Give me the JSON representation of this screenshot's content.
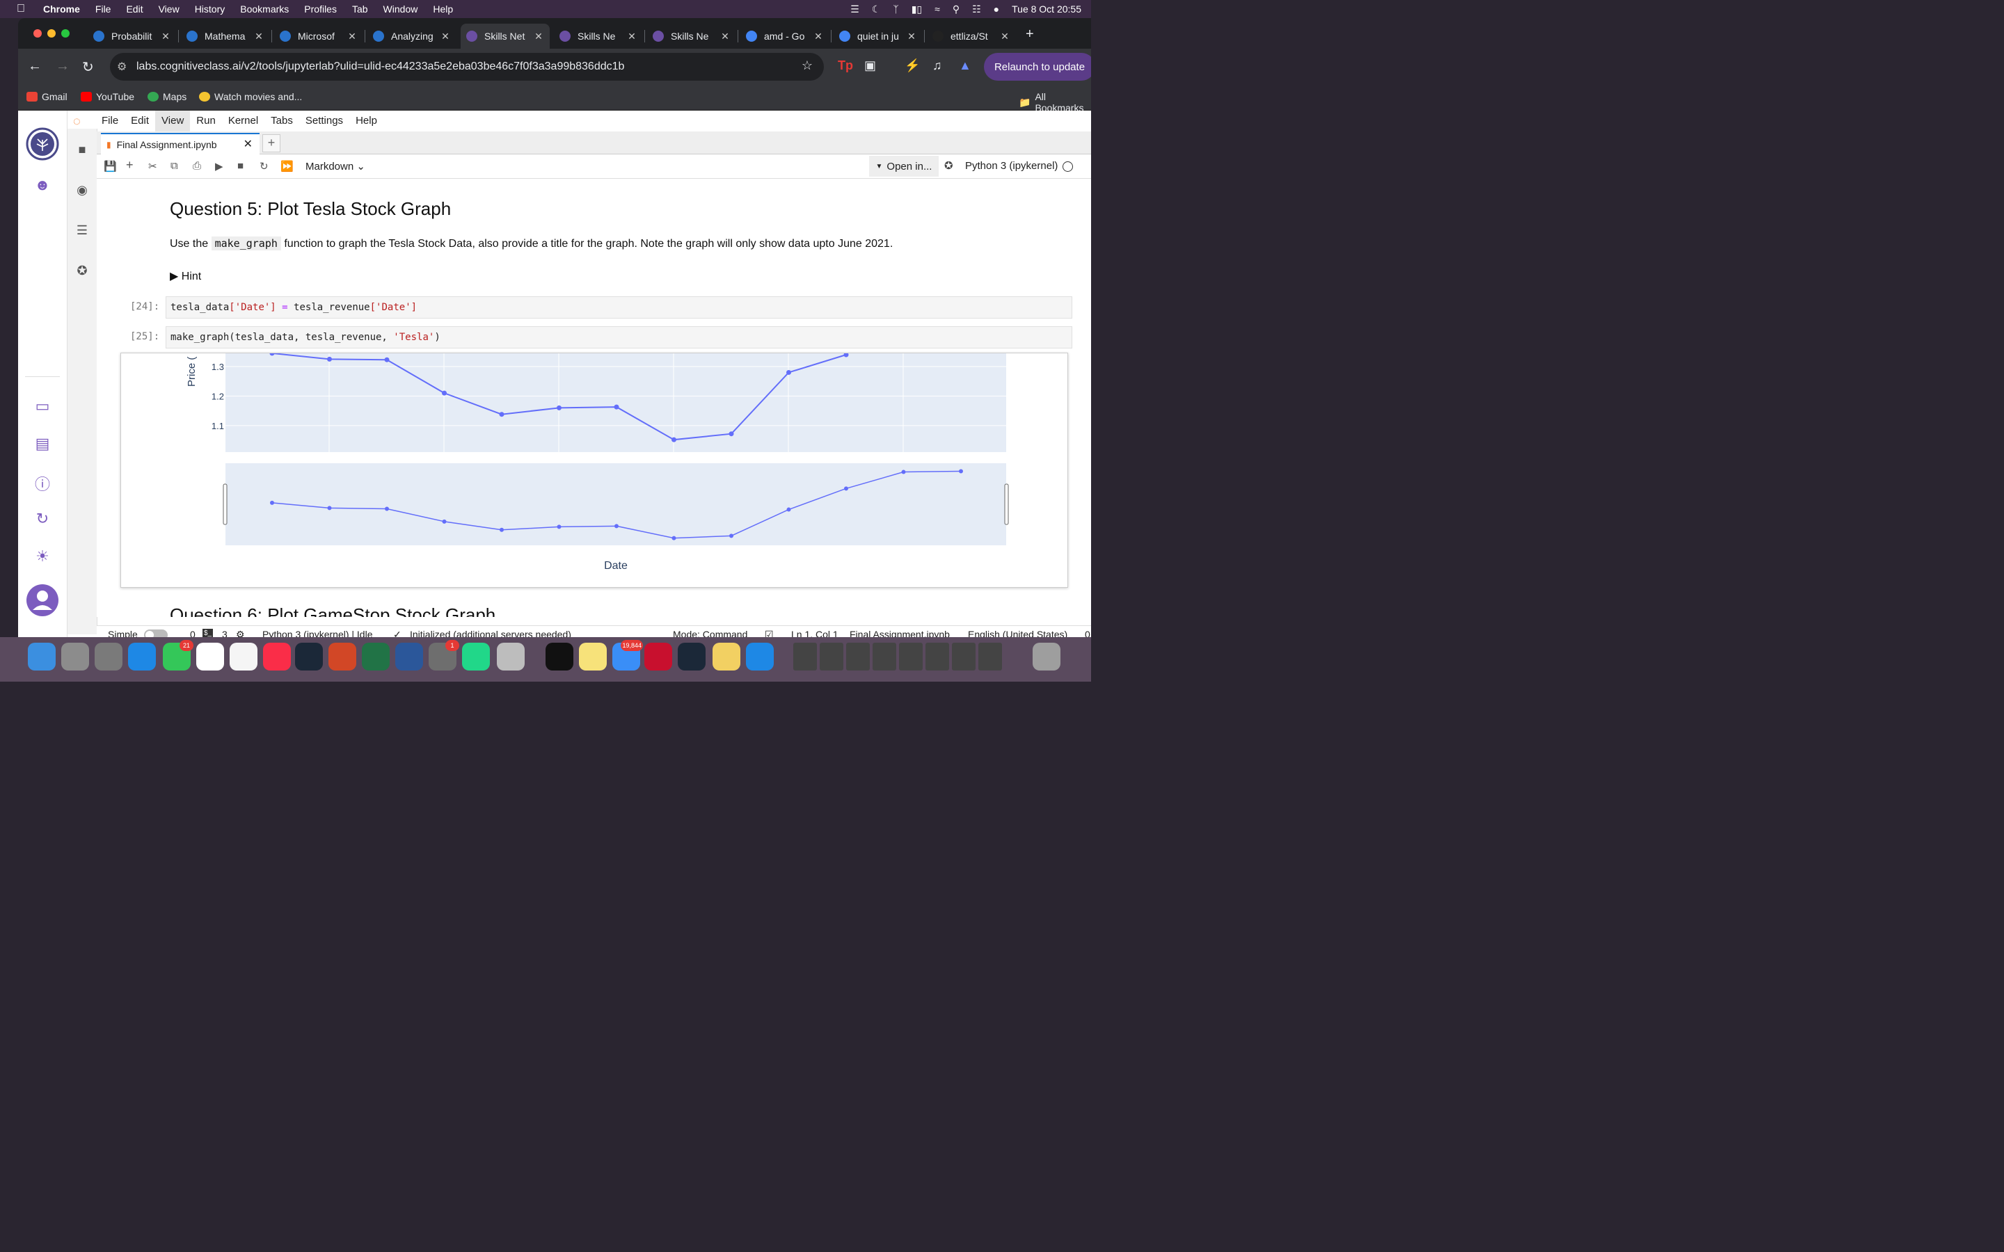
{
  "menubar": {
    "app": "Chrome",
    "items": [
      "File",
      "Edit",
      "View",
      "History",
      "Bookmarks",
      "Profiles",
      "Tab",
      "Window",
      "Help"
    ],
    "clock": "Tue 8 Oct  20:55"
  },
  "browser": {
    "tabs": [
      {
        "label": "Probabilit",
        "icon": "coursera-icon",
        "color": "#2a73cc"
      },
      {
        "label": "Mathema",
        "icon": "coursera-icon",
        "color": "#2a73cc"
      },
      {
        "label": "Microsof",
        "icon": "coursera-icon",
        "color": "#2a73cc"
      },
      {
        "label": "Analyzing",
        "icon": "coursera-icon",
        "color": "#2a73cc"
      },
      {
        "label": "Skills Net",
        "icon": "skillsnetwork-icon",
        "color": "#6b4fa3"
      },
      {
        "label": "Skills Ne",
        "icon": "skillsnetwork-icon",
        "color": "#6b4fa3"
      },
      {
        "label": "Skills Ne",
        "icon": "skillsnetwork-icon",
        "color": "#6b4fa3"
      },
      {
        "label": "amd - Go",
        "icon": "google-icon",
        "color": "#4285f4"
      },
      {
        "label": "quiet in ju",
        "icon": "google-icon",
        "color": "#4285f4"
      },
      {
        "label": "ettliza/St",
        "icon": "github-icon",
        "color": "#222222"
      }
    ],
    "url": "labs.cognitiveclass.ai/v2/tools/jupyterlab?ulid=ulid-ec44233a5e2eba03be46c7f0f3a3a99b836ddc1b",
    "relaunch": "Relaunch to update",
    "bookmarks": [
      "Gmail",
      "YouTube",
      "Maps",
      "Watch movies and..."
    ],
    "all_bookmarks": "All Bookmarks"
  },
  "jupyter": {
    "menu": [
      "File",
      "Edit",
      "View",
      "Run",
      "Kernel",
      "Tabs",
      "Settings",
      "Help"
    ],
    "doc_tab": "Final Assignment.ipynb",
    "cell_type": "Markdown",
    "open_in": "Open in...",
    "kernel": "Python 3 (ipykernel)",
    "notebook": {
      "q5_title": "Question 5: Plot Tesla Stock Graph",
      "q5_text_before": "Use the",
      "q5_code": "make_graph",
      "q5_text_after": "function to graph the Tesla Stock Data, also provide a title for the graph. Note the graph will only show data upto June 2021.",
      "hint": "Hint",
      "cells": [
        {
          "prompt": "[24]:"
        },
        {
          "prompt": "[25]:"
        }
      ],
      "next_heading": "Question 6: Plot GameStop Stock Graph"
    },
    "status": {
      "mode_label": "Simple",
      "count0": "0",
      "count3": "3",
      "kernel_status": "Python 3 (ipykernel) | Idle",
      "init": "Initialized (additional servers needed)",
      "mode": "Mode: Command",
      "cursor": "Ln 1, Col 1",
      "file": "Final Assignment.ipynb",
      "lang": "English (United States)",
      "tail": "0"
    }
  },
  "chart_data": {
    "type": "line",
    "ylabel": "Price (",
    "xlabel": "Date",
    "yticks": [
      "1.3",
      "1.2",
      "1.1"
    ],
    "upper": {
      "ylim": [
        1.01,
        1.34
      ],
      "values": [
        1.345,
        1.325,
        1.323,
        1.21,
        1.138,
        1.16,
        1.163,
        1.052,
        1.072,
        1.28,
        1.34
      ],
      "color": "#636efa"
    },
    "lower": {
      "values": [
        0.52,
        0.45,
        0.44,
        0.27,
        0.16,
        0.2,
        0.21,
        0.05,
        0.08,
        0.43,
        0.71,
        0.93,
        0.94
      ],
      "color": "#636efa"
    },
    "background": "#e5ecf6",
    "grid": true
  },
  "dock": [
    "Finder",
    "Launchpad",
    "Help",
    "Safari",
    "Messages",
    "Chrome",
    "Photos",
    "Music",
    "Steam",
    "PowerPoint",
    "Excel",
    "Word",
    "System Settings",
    "PyCharm",
    "Roblox",
    "Terminal",
    "Notes",
    "Mail",
    "Express",
    "Steam",
    "Stickies",
    "App Store"
  ],
  "dock_badges": {
    "messages": "21",
    "settings": "1",
    "mail": "19,844"
  }
}
